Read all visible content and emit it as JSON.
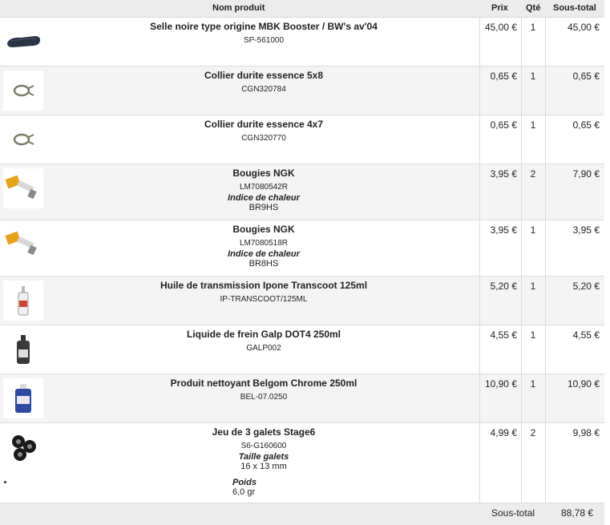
{
  "header": {
    "product": "Nom produit",
    "price": "Prix",
    "qty": "Qté",
    "subtotal": "Sous-total"
  },
  "items": [
    {
      "name": "Selle noire type origine MBK Booster / BW's av'04",
      "ref": "SP-561000",
      "price": "45,00 €",
      "qty": "1",
      "subtotal": "45,00 €",
      "icon": "seat-icon"
    },
    {
      "name": "Collier durite essence 5x8",
      "ref": "CGN320784",
      "price": "0,65 €",
      "qty": "1",
      "subtotal": "0,65 €",
      "icon": "hose-clamp-icon"
    },
    {
      "name": "Collier durite essence 4x7",
      "ref": "CGN320770",
      "price": "0,65 €",
      "qty": "1",
      "subtotal": "0,65 €",
      "icon": "hose-clamp-icon"
    },
    {
      "name": "Bougies NGK",
      "ref": "LM7080542R",
      "attr_label": "Indice de chaleur",
      "attr_value": "BR9HS",
      "price": "3,95 €",
      "qty": "2",
      "subtotal": "7,90 €",
      "icon": "spark-plug-icon"
    },
    {
      "name": "Bougies NGK",
      "ref": "LM7080518R",
      "attr_label": "Indice de chaleur",
      "attr_value": "BR8HS",
      "price": "3,95 €",
      "qty": "1",
      "subtotal": "3,95 €",
      "icon": "spark-plug-icon"
    },
    {
      "name": "Huile de transmission Ipone Transcoot 125ml",
      "ref": "IP-TRANSCOOT/125ML",
      "price": "5,20 €",
      "qty": "1",
      "subtotal": "5,20 €",
      "icon": "oil-bottle-icon"
    },
    {
      "name": "Liquide de frein Galp DOT4 250ml",
      "ref": "GALP002",
      "price": "4,55 €",
      "qty": "1",
      "subtotal": "4,55 €",
      "icon": "brake-fluid-bottle-icon"
    },
    {
      "name": "Produit nettoyant Belgom Chrome 250ml",
      "ref": "BEL-07.0250",
      "price": "10,90 €",
      "qty": "1",
      "subtotal": "10,90 €",
      "icon": "cleaner-bottle-icon"
    },
    {
      "name": "Jeu de 3 galets Stage6",
      "ref": "S6-G160600",
      "attr_label": "Taille galets",
      "attr_value": "16 x 13 mm",
      "attr2_label": "Poids",
      "attr2_value": "6,0 gr",
      "price": "4,99 €",
      "qty": "2",
      "subtotal": "9,98 €",
      "icon": "rollers-icon"
    }
  ],
  "footer": {
    "label": "Sous-total",
    "total": "88,78 €"
  }
}
